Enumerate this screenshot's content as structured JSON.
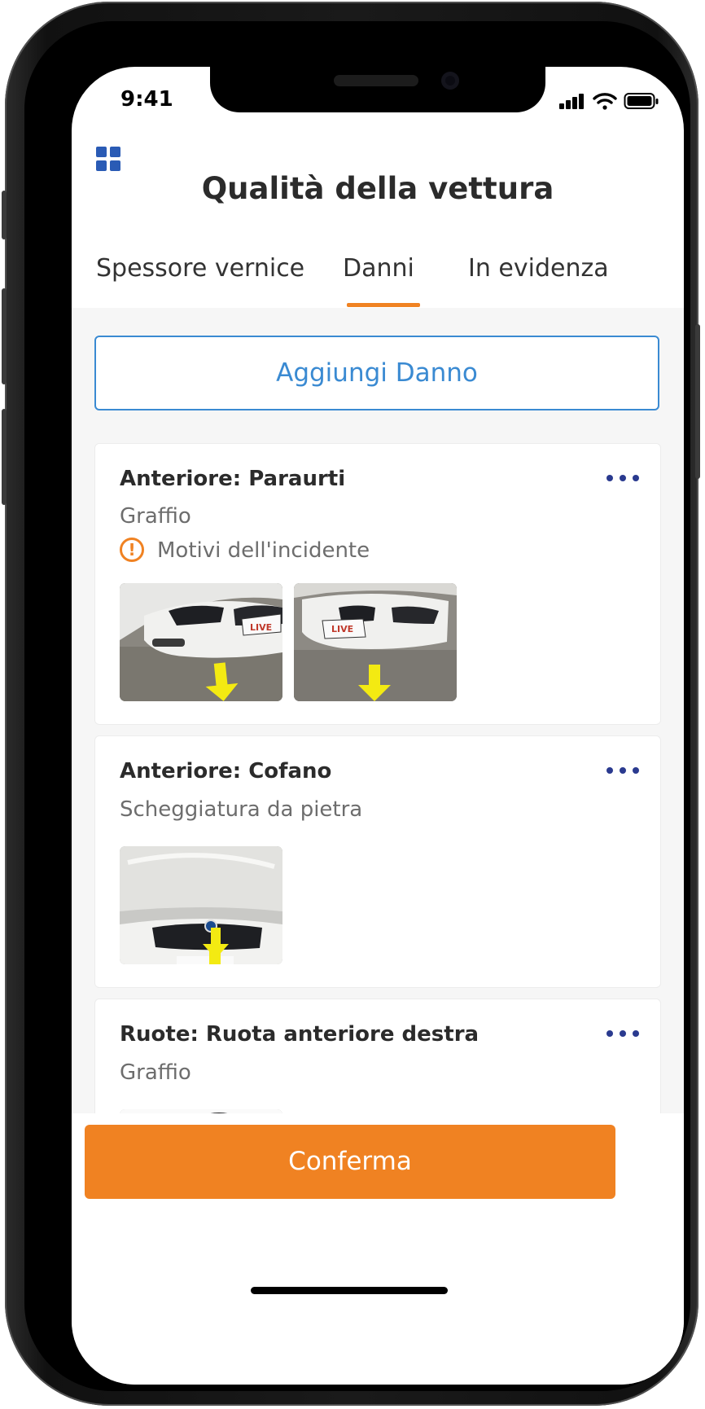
{
  "status": {
    "time": "9:41"
  },
  "header": {
    "title": "Qualità della vettura",
    "menu_icon": "grid-icon"
  },
  "tabs": [
    {
      "label": "Spessore vernice",
      "active": false
    },
    {
      "label": "Danni",
      "active": true
    },
    {
      "label": "In evidenza",
      "active": false
    }
  ],
  "actions": {
    "add_damage": "Aggiungi Danno",
    "confirm": "Conferma"
  },
  "damages": [
    {
      "title": "Anteriore: Paraurti",
      "type": "Graffio",
      "warning": "Motivi dell'incidente",
      "photos": 2
    },
    {
      "title": "Anteriore: Cofano",
      "type": "Scheggiatura da pietra",
      "photos": 1
    },
    {
      "title": "Ruote: Ruota anteriore destra",
      "type": "Graffio",
      "photos": 1
    }
  ],
  "colors": {
    "accent": "#f08222",
    "link": "#3a8ad2",
    "icon": "#2a5bb5"
  }
}
